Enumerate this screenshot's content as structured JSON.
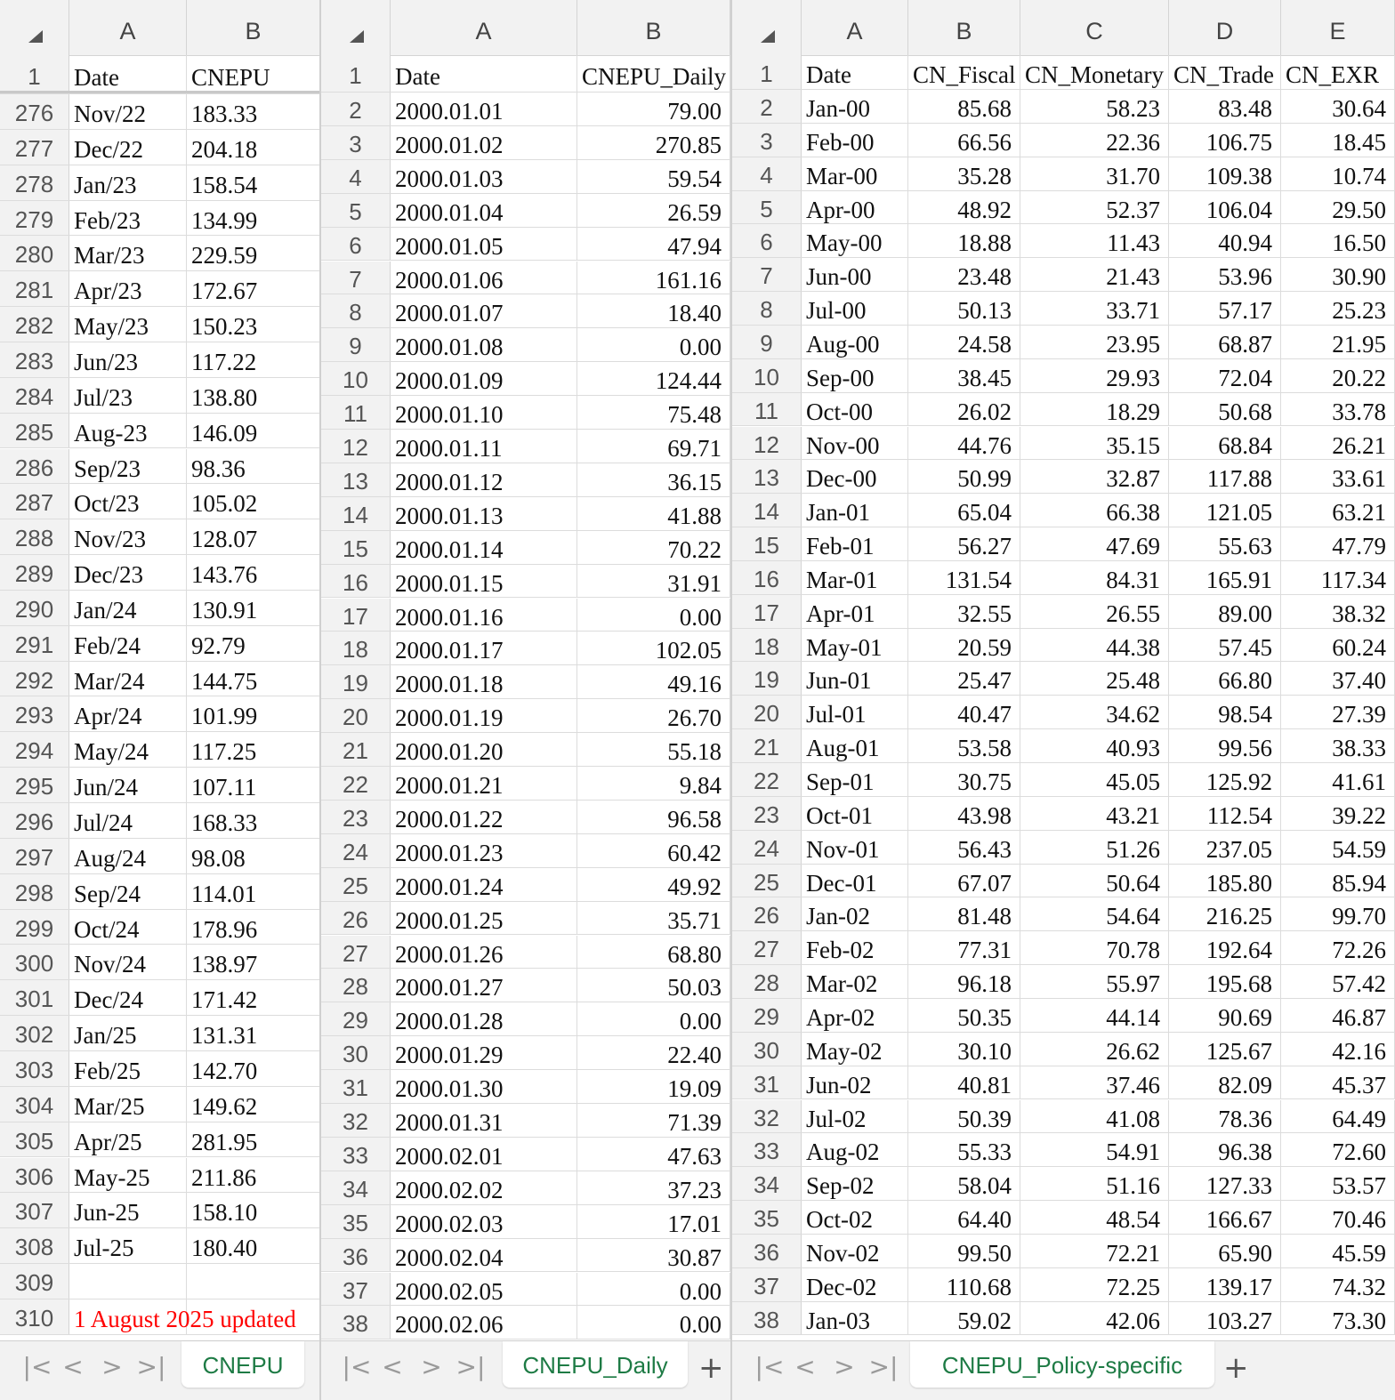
{
  "panels": [
    {
      "columns": [
        "A",
        "B"
      ],
      "header_row": {
        "num": "1",
        "cells": [
          "Date",
          "CNEPU"
        ]
      },
      "rows": [
        [
          "276",
          "Nov/22",
          "183.33"
        ],
        [
          "277",
          "Dec/22",
          "204.18"
        ],
        [
          "278",
          "Jan/23",
          "158.54"
        ],
        [
          "279",
          "Feb/23",
          "134.99"
        ],
        [
          "280",
          "Mar/23",
          "229.59"
        ],
        [
          "281",
          "Apr/23",
          "172.67"
        ],
        [
          "282",
          "May/23",
          "150.23"
        ],
        [
          "283",
          "Jun/23",
          "117.22"
        ],
        [
          "284",
          "Jul/23",
          "138.80"
        ],
        [
          "285",
          "Aug-23",
          "146.09"
        ],
        [
          "286",
          "Sep/23",
          "98.36"
        ],
        [
          "287",
          "Oct/23",
          "105.02"
        ],
        [
          "288",
          "Nov/23",
          "128.07"
        ],
        [
          "289",
          "Dec/23",
          "143.76"
        ],
        [
          "290",
          "Jan/24",
          "130.91"
        ],
        [
          "291",
          "Feb/24",
          "92.79"
        ],
        [
          "292",
          "Mar/24",
          "144.75"
        ],
        [
          "293",
          "Apr/24",
          "101.99"
        ],
        [
          "294",
          "May/24",
          "117.25"
        ],
        [
          "295",
          "Jun/24",
          "107.11"
        ],
        [
          "296",
          "Jul/24",
          "168.33"
        ],
        [
          "297",
          "Aug/24",
          "98.08"
        ],
        [
          "298",
          "Sep/24",
          "114.01"
        ],
        [
          "299",
          "Oct/24",
          "178.96"
        ],
        [
          "300",
          "Nov/24",
          "138.97"
        ],
        [
          "301",
          "Dec/24",
          "171.42"
        ],
        [
          "302",
          "Jan/25",
          "131.31"
        ],
        [
          "303",
          "Feb/25",
          "142.70"
        ],
        [
          "304",
          "Mar/25",
          "149.62"
        ],
        [
          "305",
          "Apr/25",
          "281.95"
        ],
        [
          "306",
          "May-25",
          "211.86"
        ],
        [
          "307",
          "Jun-25",
          "158.10"
        ],
        [
          "308",
          "Jul-25",
          "180.40"
        ],
        [
          "309",
          "",
          ""
        ],
        [
          "310",
          "1 August 2025 updated",
          ""
        ]
      ],
      "note_color": "#ff0000",
      "tab_label": "CNEPU"
    },
    {
      "columns": [
        "A",
        "B"
      ],
      "header_row": {
        "num": "1",
        "cells": [
          "Date",
          "CNEPU_Daily"
        ]
      },
      "rows": [
        [
          "2",
          "2000.01.01",
          "79.00"
        ],
        [
          "3",
          "2000.01.02",
          "270.85"
        ],
        [
          "4",
          "2000.01.03",
          "59.54"
        ],
        [
          "5",
          "2000.01.04",
          "26.59"
        ],
        [
          "6",
          "2000.01.05",
          "47.94"
        ],
        [
          "7",
          "2000.01.06",
          "161.16"
        ],
        [
          "8",
          "2000.01.07",
          "18.40"
        ],
        [
          "9",
          "2000.01.08",
          "0.00"
        ],
        [
          "10",
          "2000.01.09",
          "124.44"
        ],
        [
          "11",
          "2000.01.10",
          "75.48"
        ],
        [
          "12",
          "2000.01.11",
          "69.71"
        ],
        [
          "13",
          "2000.01.12",
          "36.15"
        ],
        [
          "14",
          "2000.01.13",
          "41.88"
        ],
        [
          "15",
          "2000.01.14",
          "70.22"
        ],
        [
          "16",
          "2000.01.15",
          "31.91"
        ],
        [
          "17",
          "2000.01.16",
          "0.00"
        ],
        [
          "18",
          "2000.01.17",
          "102.05"
        ],
        [
          "19",
          "2000.01.18",
          "49.16"
        ],
        [
          "20",
          "2000.01.19",
          "26.70"
        ],
        [
          "21",
          "2000.01.20",
          "55.18"
        ],
        [
          "22",
          "2000.01.21",
          "9.84"
        ],
        [
          "23",
          "2000.01.22",
          "96.58"
        ],
        [
          "24",
          "2000.01.23",
          "60.42"
        ],
        [
          "25",
          "2000.01.24",
          "49.92"
        ],
        [
          "26",
          "2000.01.25",
          "35.71"
        ],
        [
          "27",
          "2000.01.26",
          "68.80"
        ],
        [
          "28",
          "2000.01.27",
          "50.03"
        ],
        [
          "29",
          "2000.01.28",
          "0.00"
        ],
        [
          "30",
          "2000.01.29",
          "22.40"
        ],
        [
          "31",
          "2000.01.30",
          "19.09"
        ],
        [
          "32",
          "2000.01.31",
          "71.39"
        ],
        [
          "33",
          "2000.02.01",
          "47.63"
        ],
        [
          "34",
          "2000.02.02",
          "37.23"
        ],
        [
          "35",
          "2000.02.03",
          "17.01"
        ],
        [
          "36",
          "2000.02.04",
          "30.87"
        ],
        [
          "37",
          "2000.02.05",
          "0.00"
        ],
        [
          "38",
          "2000.02.06",
          "0.00"
        ]
      ],
      "tab_label": "CNEPU_Daily"
    },
    {
      "columns": [
        "A",
        "B",
        "C",
        "D",
        "E"
      ],
      "header_row": {
        "num": "1",
        "cells": [
          "Date",
          "CN_Fiscal",
          "CN_Monetary",
          "CN_Trade",
          "CN_EXR"
        ]
      },
      "rows": [
        [
          "2",
          "Jan-00",
          "85.68",
          "58.23",
          "83.48",
          "30.64"
        ],
        [
          "3",
          "Feb-00",
          "66.56",
          "22.36",
          "106.75",
          "18.45"
        ],
        [
          "4",
          "Mar-00",
          "35.28",
          "31.70",
          "109.38",
          "10.74"
        ],
        [
          "5",
          "Apr-00",
          "48.92",
          "52.37",
          "106.04",
          "29.50"
        ],
        [
          "6",
          "May-00",
          "18.88",
          "11.43",
          "40.94",
          "16.50"
        ],
        [
          "7",
          "Jun-00",
          "23.48",
          "21.43",
          "53.96",
          "30.90"
        ],
        [
          "8",
          "Jul-00",
          "50.13",
          "33.71",
          "57.17",
          "25.23"
        ],
        [
          "9",
          "Aug-00",
          "24.58",
          "23.95",
          "68.87",
          "21.95"
        ],
        [
          "10",
          "Sep-00",
          "38.45",
          "29.93",
          "72.04",
          "20.22"
        ],
        [
          "11",
          "Oct-00",
          "26.02",
          "18.29",
          "50.68",
          "33.78"
        ],
        [
          "12",
          "Nov-00",
          "44.76",
          "35.15",
          "68.84",
          "26.21"
        ],
        [
          "13",
          "Dec-00",
          "50.99",
          "32.87",
          "117.88",
          "33.61"
        ],
        [
          "14",
          "Jan-01",
          "65.04",
          "66.38",
          "121.05",
          "63.21"
        ],
        [
          "15",
          "Feb-01",
          "56.27",
          "47.69",
          "55.63",
          "47.79"
        ],
        [
          "16",
          "Mar-01",
          "131.54",
          "84.31",
          "165.91",
          "117.34"
        ],
        [
          "17",
          "Apr-01",
          "32.55",
          "26.55",
          "89.00",
          "38.32"
        ],
        [
          "18",
          "May-01",
          "20.59",
          "44.38",
          "57.45",
          "60.24"
        ],
        [
          "19",
          "Jun-01",
          "25.47",
          "25.48",
          "66.80",
          "37.40"
        ],
        [
          "20",
          "Jul-01",
          "40.47",
          "34.62",
          "98.54",
          "27.39"
        ],
        [
          "21",
          "Aug-01",
          "53.58",
          "40.93",
          "99.56",
          "38.33"
        ],
        [
          "22",
          "Sep-01",
          "30.75",
          "45.05",
          "125.92",
          "41.61"
        ],
        [
          "23",
          "Oct-01",
          "43.98",
          "43.21",
          "112.54",
          "39.22"
        ],
        [
          "24",
          "Nov-01",
          "56.43",
          "51.26",
          "237.05",
          "54.59"
        ],
        [
          "25",
          "Dec-01",
          "67.07",
          "50.64",
          "185.80",
          "85.94"
        ],
        [
          "26",
          "Jan-02",
          "81.48",
          "54.64",
          "216.25",
          "99.70"
        ],
        [
          "27",
          "Feb-02",
          "77.31",
          "70.78",
          "192.64",
          "72.26"
        ],
        [
          "28",
          "Mar-02",
          "96.18",
          "55.97",
          "195.68",
          "57.42"
        ],
        [
          "29",
          "Apr-02",
          "50.35",
          "44.14",
          "90.69",
          "46.87"
        ],
        [
          "30",
          "May-02",
          "30.10",
          "26.62",
          "125.67",
          "42.16"
        ],
        [
          "31",
          "Jun-02",
          "40.81",
          "37.46",
          "82.09",
          "45.37"
        ],
        [
          "32",
          "Jul-02",
          "50.39",
          "41.08",
          "78.36",
          "64.49"
        ],
        [
          "33",
          "Aug-02",
          "55.33",
          "54.91",
          "96.38",
          "72.60"
        ],
        [
          "34",
          "Sep-02",
          "58.04",
          "51.16",
          "127.33",
          "53.57"
        ],
        [
          "35",
          "Oct-02",
          "64.40",
          "48.54",
          "166.67",
          "70.46"
        ],
        [
          "36",
          "Nov-02",
          "99.50",
          "72.21",
          "65.90",
          "45.59"
        ],
        [
          "37",
          "Dec-02",
          "110.68",
          "72.25",
          "139.17",
          "74.32"
        ],
        [
          "38",
          "Jan-03",
          "59.02",
          "42.06",
          "103.27",
          "73.30"
        ]
      ],
      "tab_label": "CNEPU_Policy-specific"
    }
  ],
  "nav_icons": [
    "first-sheet-icon",
    "prev-sheet-icon",
    "next-sheet-icon",
    "last-sheet-icon"
  ],
  "nav_glyphs": [
    "|<",
    "<",
    ">",
    ">|"
  ],
  "add_sheet_glyph": "+",
  "colors": {
    "tab_text": "#1e7b45",
    "header_bg": "#f2f2f2",
    "note_text": "#ff0000"
  }
}
